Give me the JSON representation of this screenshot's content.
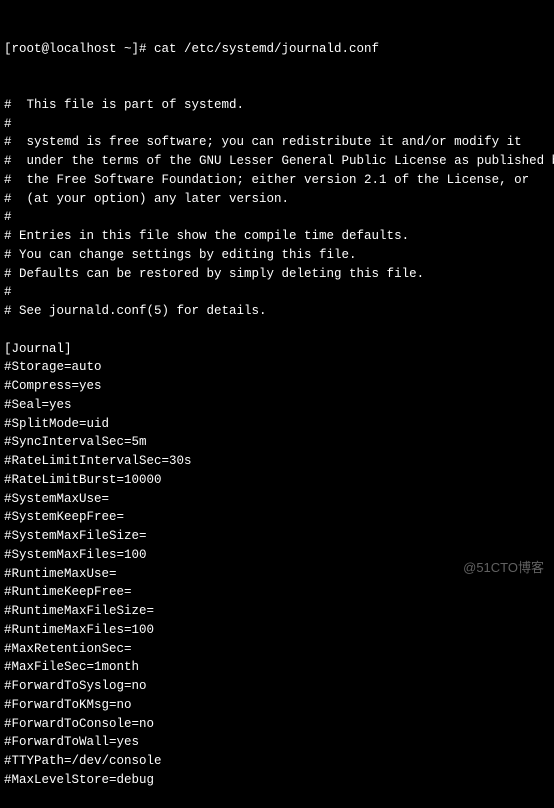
{
  "prompt": "[root@localhost ~]# cat /etc/systemd/journald.conf",
  "lines": [
    "#  This file is part of systemd.",
    "#",
    "#  systemd is free software; you can redistribute it and/or modify it",
    "#  under the terms of the GNU Lesser General Public License as published by",
    "#  the Free Software Foundation; either version 2.1 of the License, or",
    "#  (at your option) any later version.",
    "#",
    "# Entries in this file show the compile time defaults.",
    "# You can change settings by editing this file.",
    "# Defaults can be restored by simply deleting this file.",
    "#",
    "# See journald.conf(5) for details.",
    "",
    "[Journal]",
    "#Storage=auto",
    "#Compress=yes",
    "#Seal=yes",
    "#SplitMode=uid",
    "#SyncIntervalSec=5m",
    "#RateLimitIntervalSec=30s",
    "#RateLimitBurst=10000",
    "#SystemMaxUse=",
    "#SystemKeepFree=",
    "#SystemMaxFileSize=",
    "#SystemMaxFiles=100",
    "#RuntimeMaxUse=",
    "#RuntimeKeepFree=",
    "#RuntimeMaxFileSize=",
    "#RuntimeMaxFiles=100",
    "#MaxRetentionSec=",
    "#MaxFileSec=1month",
    "#ForwardToSyslog=no",
    "#ForwardToKMsg=no",
    "#ForwardToConsole=no",
    "#ForwardToWall=yes",
    "#TTYPath=/dev/console",
    "#MaxLevelStore=debug"
  ],
  "watermark": "@51CTO博客"
}
